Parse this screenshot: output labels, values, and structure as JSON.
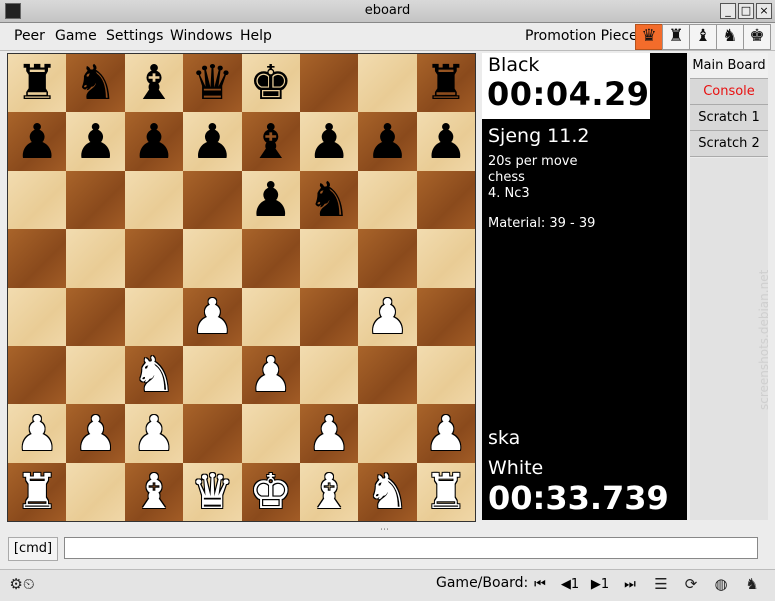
{
  "window": {
    "title": "eboard"
  },
  "menubar": {
    "items": [
      "Peer",
      "Game",
      "Settings",
      "Windows",
      "Help"
    ]
  },
  "promotion": {
    "label": "Promotion Piece",
    "pieces": [
      "♛",
      "♜",
      "♝",
      "♞",
      "♚"
    ],
    "selected": 0
  },
  "board": {
    "rows": [
      [
        "bR",
        "bN",
        "bB",
        "bQ",
        "bK",
        "",
        "",
        "bR"
      ],
      [
        "bP",
        "bP",
        "bP",
        "bP",
        "bB",
        "bP",
        "bP",
        "bP"
      ],
      [
        "",
        "",
        "",
        "",
        "bP",
        "bN",
        "",
        ""
      ],
      [
        "",
        "",
        "",
        "",
        "",
        "",
        "",
        ""
      ],
      [
        "",
        "",
        "",
        "wP",
        "",
        "",
        "wP",
        ""
      ],
      [
        "",
        "",
        "wN",
        "",
        "wP",
        "",
        "",
        ""
      ],
      [
        "wP",
        "wP",
        "wP",
        "",
        "",
        "wP",
        "",
        "wP"
      ],
      [
        "wR",
        "",
        "wB",
        "wQ",
        "wK",
        "wB",
        "wN",
        "wR"
      ]
    ]
  },
  "info": {
    "black_label": "Black",
    "black_clock": "00:04.29",
    "opponent": "Sjeng 11.2",
    "time_control": "20s per move",
    "variant": "chess",
    "last_move": "4. Nc3",
    "material": "Material: 39 - 39",
    "player": "ska",
    "white_label": "White",
    "white_clock": "00:33.739"
  },
  "tabs": [
    "Main Board",
    "Console",
    "Scratch 1",
    "Scratch 2"
  ],
  "watermark": "screenshots.debian.net",
  "command": {
    "label": "[cmd]",
    "value": ""
  },
  "statusbar": {
    "label": "Game/Board:",
    "nav": [
      "⏮",
      "◀1",
      "▶1",
      "⏭"
    ]
  }
}
